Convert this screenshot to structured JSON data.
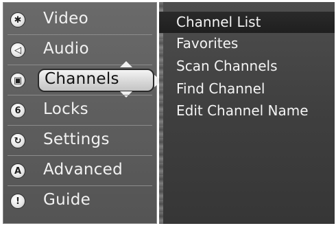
{
  "main_menu": {
    "items": [
      {
        "label": "Video",
        "icon": "video-icon",
        "glyph": "✱"
      },
      {
        "label": "Audio",
        "icon": "audio-icon",
        "glyph": "◁"
      },
      {
        "label": "Channels",
        "icon": "tv-icon",
        "glyph": "▣",
        "selected": true
      },
      {
        "label": "Locks",
        "icon": "lock-icon",
        "glyph": "6"
      },
      {
        "label": "Settings",
        "icon": "settings-icon",
        "glyph": "↻"
      },
      {
        "label": "Advanced",
        "icon": "advanced-icon",
        "glyph": "A"
      },
      {
        "label": "Guide",
        "icon": "guide-icon",
        "glyph": "!"
      }
    ]
  },
  "submenu": {
    "items": [
      {
        "label": "Channel List",
        "highlighted": true
      },
      {
        "label": "Favorites"
      },
      {
        "label": "Scan Channels"
      },
      {
        "label": "Find Channel"
      },
      {
        "label": "Edit Channel Name"
      }
    ]
  }
}
